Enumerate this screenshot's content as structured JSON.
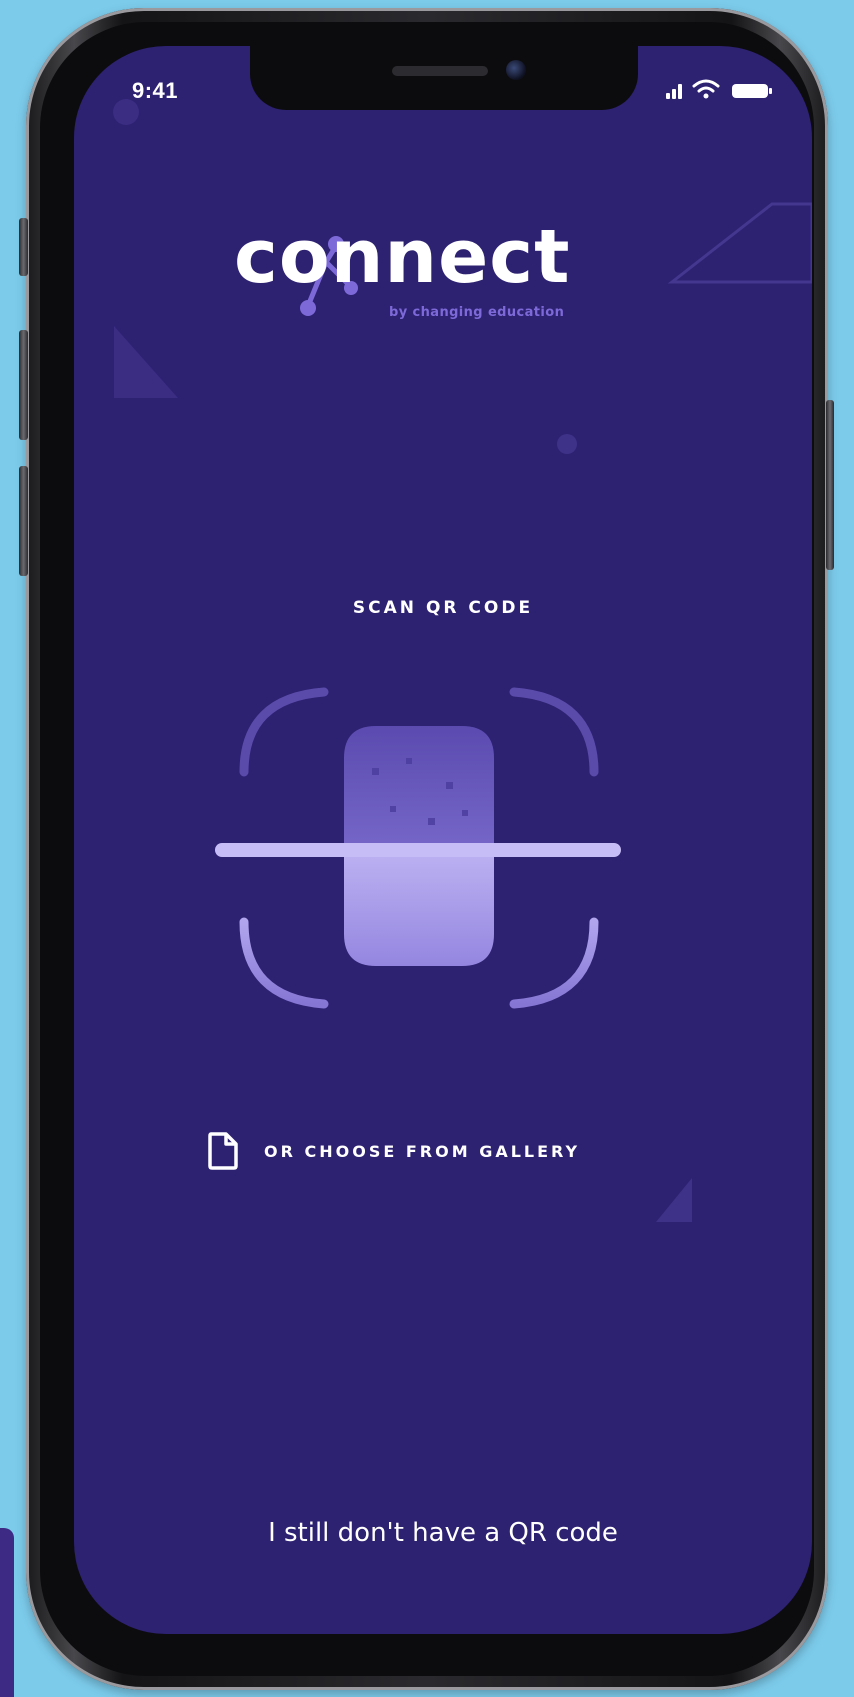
{
  "status_bar": {
    "time": "9:41",
    "icons": [
      "signal-icon",
      "wifi-icon",
      "battery-icon"
    ]
  },
  "logo": {
    "word": "connect",
    "tagline": "by changing education"
  },
  "scanner": {
    "title": "SCAN QR CODE",
    "icon": "qr-scan-frame-icon"
  },
  "gallery": {
    "label": "OR CHOOSE FROM GALLERY",
    "icon": "file-icon"
  },
  "footer": {
    "no_code_label": "I still don't have a QR code"
  },
  "colors": {
    "screen_background": "#2d2171",
    "accent": "#7d6ad8",
    "light_accent": "#b7acf2",
    "page_background": "#7ccbeb",
    "text": "#ffffff"
  }
}
